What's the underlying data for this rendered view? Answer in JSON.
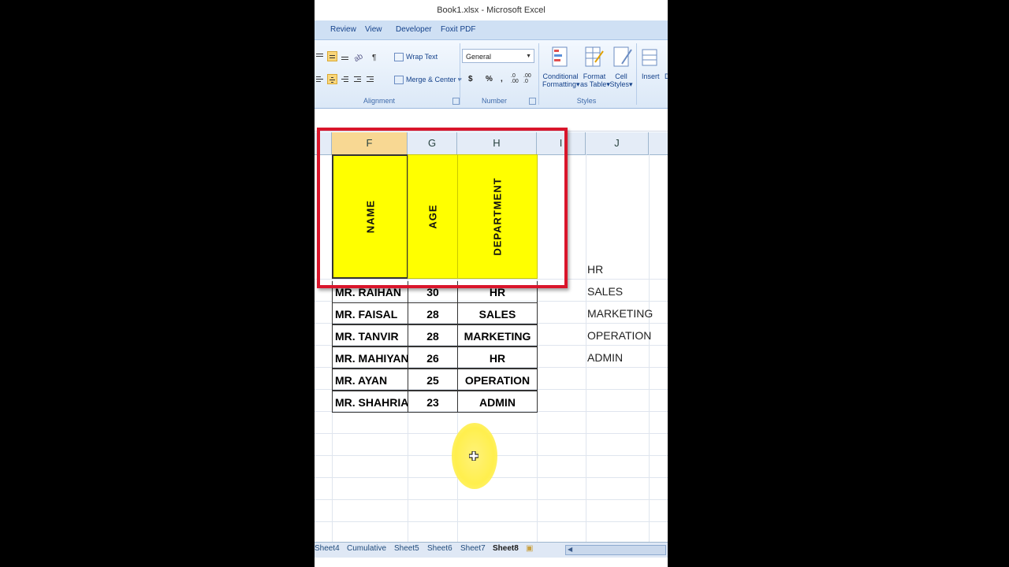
{
  "window": {
    "title": "Book1.xlsx - Microsoft Excel"
  },
  "ribbon_tabs": [
    "Review",
    "View",
    "Developer",
    "Foxit PDF"
  ],
  "ribbon": {
    "wrap_text": "Wrap Text",
    "merge_center": "Merge & Center",
    "alignment_label": "Alignment",
    "number_format": "General",
    "currency": "$",
    "percent": "%",
    "comma": ",",
    "inc_dec": ".0 .00",
    "dec_dec": ".00 .0",
    "number_label": "Number",
    "conditional_formatting": [
      "Conditional",
      "Formatting"
    ],
    "format_as_table": [
      "Format",
      "as Table"
    ],
    "cell_styles": [
      "Cell",
      "Styles"
    ],
    "styles_label": "Styles",
    "insert": "Insert",
    "delete_partial": "D"
  },
  "columns": [
    "F",
    "G",
    "H",
    "I",
    "J"
  ],
  "table": {
    "headers": [
      "NAME",
      "AGE",
      "DEPARTMENT"
    ],
    "rows": [
      [
        "MR. RAIHAN",
        "30",
        "HR"
      ],
      [
        "MR. FAISAL",
        "28",
        "SALES"
      ],
      [
        "MR. TANVIR",
        "28",
        "MARKETING"
      ],
      [
        "MR. MAHIYAN",
        "26",
        "HR"
      ],
      [
        "MR. AYAN",
        "25",
        "OPERATION"
      ],
      [
        "MR. SHAHRIAR",
        "23",
        "ADMIN"
      ]
    ]
  },
  "column_j": [
    "HR",
    "SALES",
    "MARKETING",
    "OPERATION",
    "ADMIN"
  ],
  "sheets": [
    "Sheet4",
    "Cumulative",
    "Sheet5",
    "Sheet6",
    "Sheet7",
    "Sheet8"
  ],
  "active_sheet": "Sheet8",
  "colors": {
    "highlight": "#ffff00",
    "selection_box": "#d9152b",
    "ribbon_bg": "#dbe8f7"
  }
}
